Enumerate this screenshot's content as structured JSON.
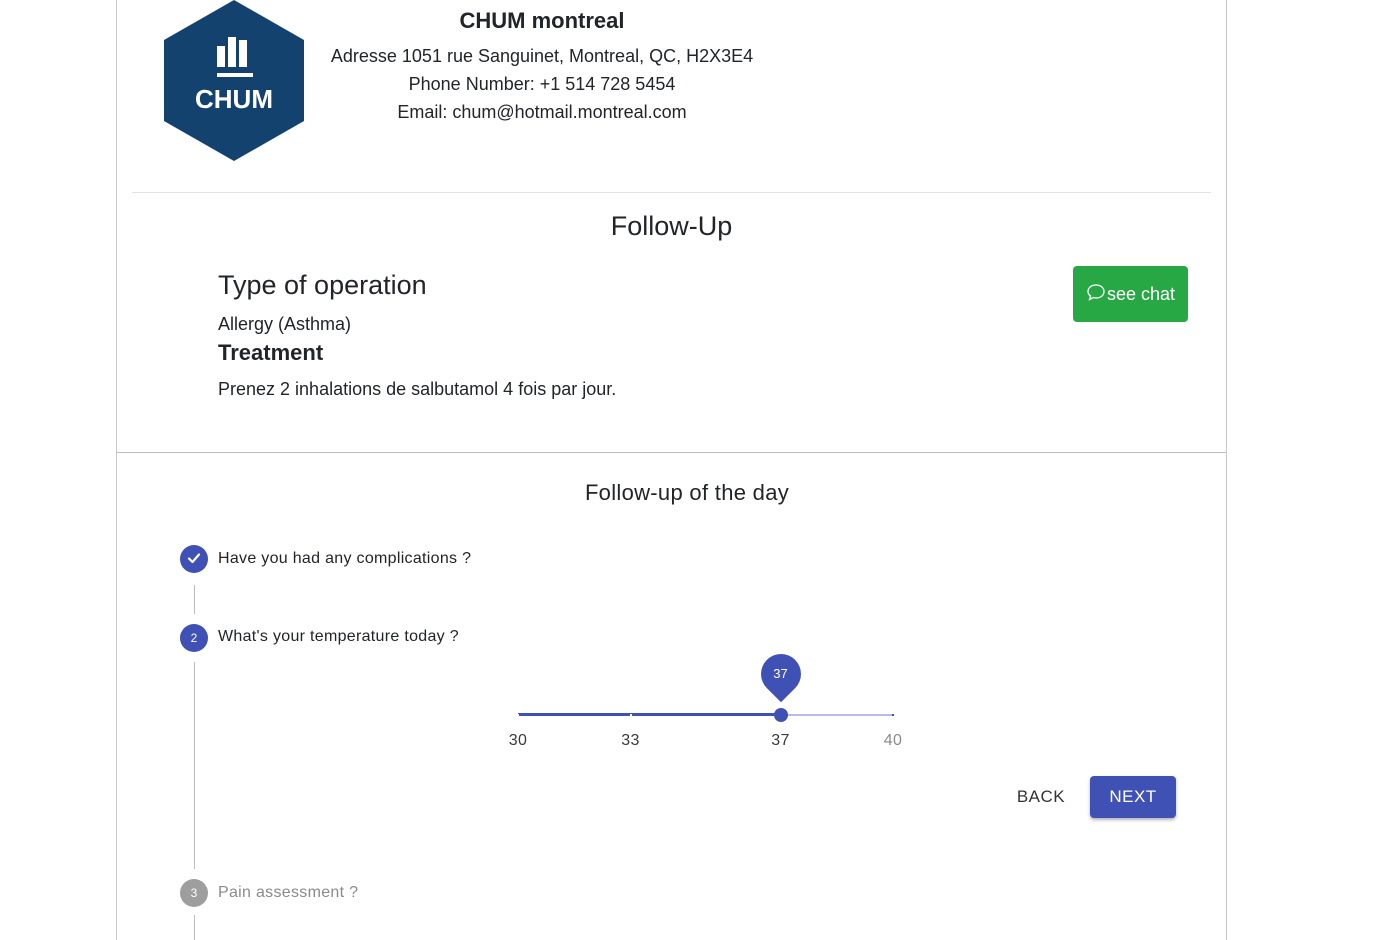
{
  "clinic": {
    "logo_text": "CHUM",
    "name": "CHUM montreal",
    "address": "Adresse 1051 rue Sanguinet, Montreal, QC, H2X3E4",
    "phone": "Phone Number: +1 514 728 5454",
    "email": "Email: chum@hotmail.montreal.com",
    "brand_color": "#13426f"
  },
  "followup": {
    "title": "Follow-Up",
    "operation_heading": "Type of operation",
    "operation_value": "Allergy (Asthma)",
    "treatment_heading": "Treatment",
    "treatment_value": "Prenez 2 inhalations de salbutamol 4 fois par jour.",
    "chat_button": "see chat",
    "chat_icon": "chat-bubble-icon",
    "chat_color": "#28a745"
  },
  "day": {
    "title": "Follow-up of the day",
    "steps": [
      {
        "number": "1",
        "label": "Have you had any complications ?",
        "status": "completed",
        "icon": "check-icon"
      },
      {
        "number": "2",
        "label": "What's your temperature today ?",
        "status": "active"
      },
      {
        "number": "3",
        "label": "Pain assessment ?",
        "status": "inactive"
      }
    ],
    "slider": {
      "min": 30,
      "max": 40,
      "value": 37,
      "value_label": "37",
      "marks": [
        {
          "value": 30,
          "label": "30"
        },
        {
          "value": 33,
          "label": "33"
        },
        {
          "value": 37,
          "label": "37"
        },
        {
          "value": 40,
          "label": "40"
        }
      ]
    },
    "back_button": "BACK",
    "next_button": "NEXT",
    "accent_color": "#3f51b5"
  }
}
